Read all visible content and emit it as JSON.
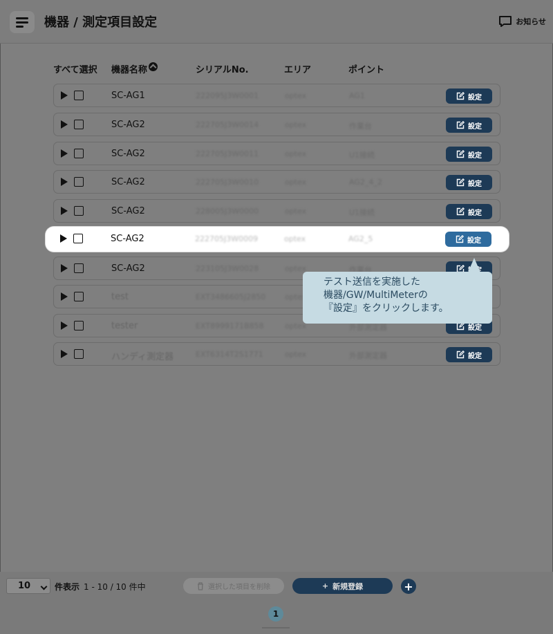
{
  "header": {
    "title": "機器 / 測定項目設定",
    "notice_label": "お知らせ"
  },
  "table": {
    "columns": {
      "select_all": "すべて選択",
      "name": "機器名称",
      "serial": "シリアルNo.",
      "area": "エリア",
      "point": "ポイント"
    },
    "set_button_label": "設定",
    "rows": [
      {
        "name": "SC-AG1",
        "serial": "222095J3W0001",
        "area": "optex",
        "point": "AG1"
      },
      {
        "name": "SC-AG2",
        "serial": "222705J3W0014",
        "area": "optex",
        "point": "作業台"
      },
      {
        "name": "SC-AG2",
        "serial": "222705J3W0011",
        "area": "optex",
        "point": "U1接続"
      },
      {
        "name": "SC-AG2",
        "serial": "222705J3W0010",
        "area": "optex",
        "point": "AG2_4_2"
      },
      {
        "name": "SC-AG2",
        "serial": "228005J3W0000",
        "area": "optex",
        "point": "U1接続"
      },
      {
        "name": "SC-AG2",
        "serial": "222705J3W0009",
        "area": "optex",
        "point": "AG2_5"
      },
      {
        "name": "SC-AG2",
        "serial": "223105J3W0028",
        "area": "optex",
        "point": "作業台"
      },
      {
        "name": "test",
        "serial": "EXT3486605J2850",
        "area": "optex",
        "point": "外部測定器"
      },
      {
        "name": "tester",
        "serial": "EXT8999171B858",
        "area": "optex",
        "point": "外部測定器"
      },
      {
        "name": "ハンディ測定器",
        "serial": "EXT6314T2S1771",
        "area": "optex",
        "point": "外部測定器"
      }
    ]
  },
  "callout": {
    "lines": [
      "テスト送信を実施した",
      "機器/GW/MultiMeterの",
      "『設定』をクリックします。"
    ]
  },
  "footer": {
    "per_page_value": "10",
    "per_page_label": "件表示",
    "range_text": "1 - 10 / 10 件中",
    "delete_label": "選択した項目を削除",
    "new_label": "新規登録",
    "plus_label": "+",
    "current_page": "1"
  },
  "colors": {
    "accent": "#1d3a56",
    "accent_active": "#2e6b9e",
    "callout_bg": "#c6dbe3",
    "overlay": "#7f7f7f"
  }
}
